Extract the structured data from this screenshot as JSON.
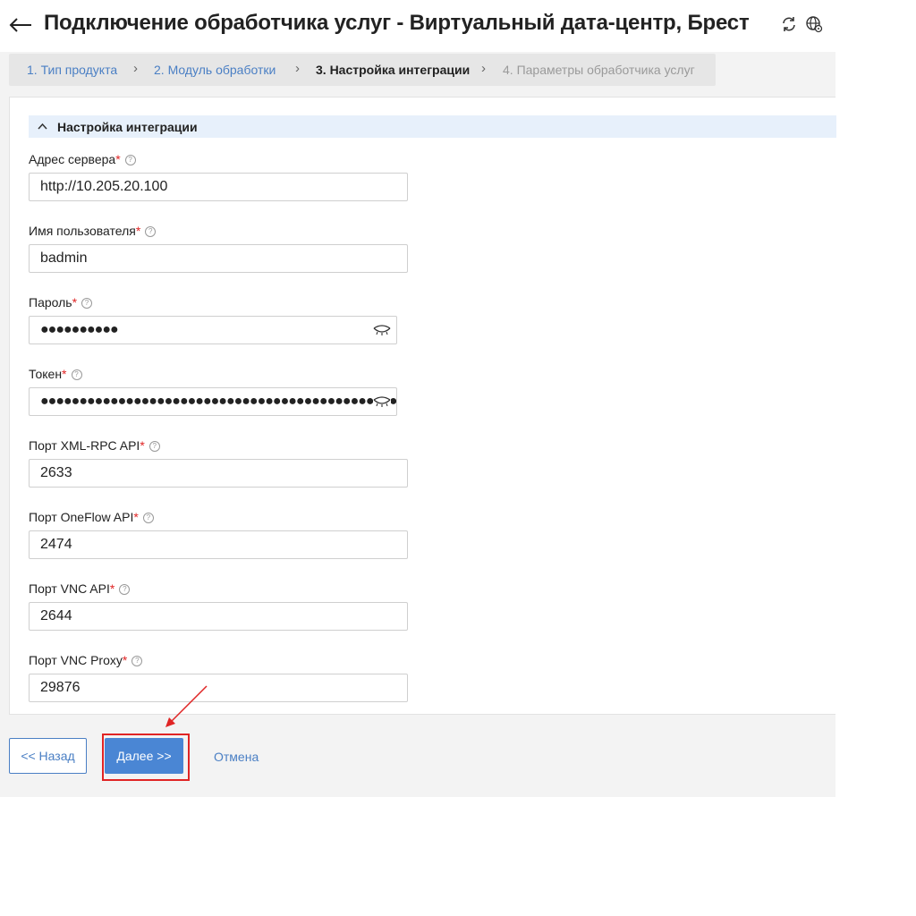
{
  "header": {
    "title": "Подключение обработчика услуг - Виртуальный дата-центр, Брест",
    "icons": [
      "back-arrow-icon",
      "refresh-icon",
      "globe-settings-icon"
    ]
  },
  "steps": [
    {
      "label": "1. Тип продукта",
      "state": "done"
    },
    {
      "label": "2. Модуль обработки",
      "state": "done"
    },
    {
      "label": "3. Настройка интеграции",
      "state": "current"
    },
    {
      "label": "4. Параметры обработчика услуг",
      "state": "future"
    }
  ],
  "step_separator": "›",
  "section": {
    "title": "Настройка интеграции",
    "expanded": true
  },
  "fields": [
    {
      "label": "Адрес сервера",
      "required": "*",
      "help": "?",
      "value": "http://10.205.20.100"
    },
    {
      "label": "Имя пользователя",
      "required": "*",
      "help": "?",
      "value": "badmin"
    },
    {
      "label": "Пароль",
      "required": "*",
      "help": "?",
      "value": "●●●●●●●●●●"
    },
    {
      "label": "Токен",
      "required": "*",
      "help": "?",
      "value": "●●●●●●●●●●●●●●●●●●●●●●●●●●●●●●●●●●●●●●●●●●●●●●●●●●●●●●●●●●●●●●●●"
    },
    {
      "label": "Порт XML-RPC API",
      "required": "*",
      "help": "?",
      "value": "2633"
    },
    {
      "label": "Порт OneFlow API",
      "required": "*",
      "help": "?",
      "value": "2474"
    },
    {
      "label": "Порт VNC API",
      "required": "*",
      "help": "?",
      "value": "2644"
    },
    {
      "label": "Порт VNC Proxy",
      "required": "*",
      "help": "?",
      "value": "29876"
    }
  ],
  "buttons": {
    "back": "<< Назад",
    "next": "Далее >>",
    "cancel": "Отмена"
  },
  "colors": {
    "accent": "#4a86d4",
    "link": "#4a7fc4",
    "required": "#e02424",
    "annotation": "#e02424",
    "section_bg": "#e7f0fb"
  }
}
